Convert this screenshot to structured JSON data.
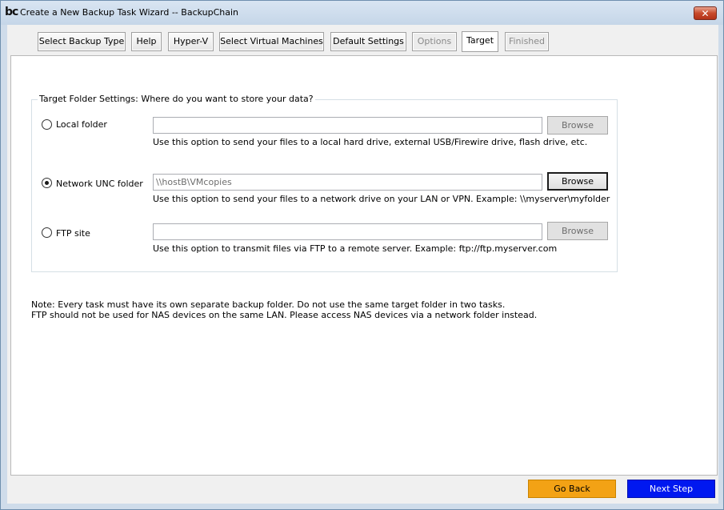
{
  "window": {
    "logo_text": "bc",
    "title": "Create a New Backup Task Wizard -- BackupChain",
    "close_glyph": "✕"
  },
  "tabs": [
    {
      "label": "Select Backup Type",
      "state": "normal"
    },
    {
      "label": "Help",
      "state": "normal"
    },
    {
      "label": "Hyper-V",
      "state": "normal"
    },
    {
      "label": "Select Virtual Machines",
      "state": "normal"
    },
    {
      "label": "Default Settings",
      "state": "normal"
    },
    {
      "label": "Options",
      "state": "disabled"
    },
    {
      "label": "Target",
      "state": "active"
    },
    {
      "label": "Finished",
      "state": "disabled"
    }
  ],
  "group": {
    "legend": "Target Folder Settings: Where do you want to store your data?",
    "options": [
      {
        "label": "Local folder",
        "selected": false,
        "value": "",
        "browse_label": "Browse",
        "browse_enabled": false,
        "hint": "Use this option to send your files to a local hard drive, external USB/Firewire drive, flash drive, etc."
      },
      {
        "label": "Network UNC folder",
        "selected": true,
        "value": "\\\\hostB\\VMcopies",
        "browse_label": "Browse",
        "browse_enabled": true,
        "hint": "Use this option to send your files to a network drive on your LAN or VPN. Example: \\\\myserver\\myfolder"
      },
      {
        "label": "FTP site",
        "selected": false,
        "value": "",
        "browse_label": "Browse",
        "browse_enabled": false,
        "hint": "Use this option to transmit files via FTP to a remote server. Example: ftp://ftp.myserver.com"
      }
    ]
  },
  "notes": [
    "Note: Every task must have its own separate backup folder. Do not use the same target folder in two tasks.",
    "FTP should not be used for NAS devices on the same LAN. Please access NAS devices via a network folder instead."
  ],
  "buttons": {
    "back_label": "Go Back",
    "next_label": "Next Step"
  },
  "colors": {
    "back_button": "#f3a215",
    "next_button": "#0018f0"
  }
}
